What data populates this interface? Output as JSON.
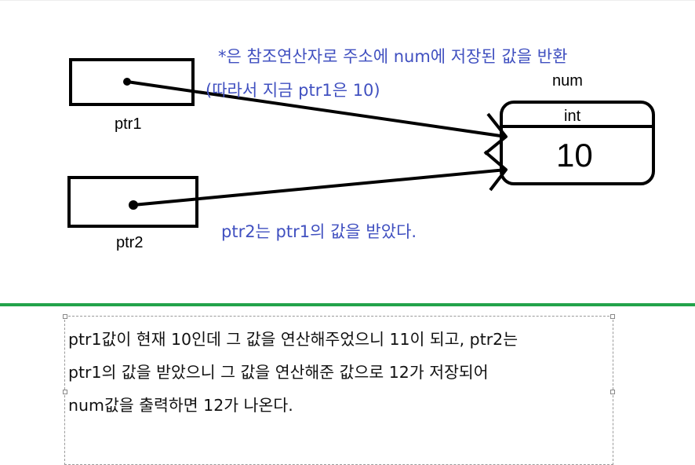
{
  "pointers": [
    {
      "name": "ptr1"
    },
    {
      "name": "ptr2"
    }
  ],
  "variable": {
    "name": "num",
    "type": "int",
    "value": "10"
  },
  "annotations": {
    "deref_line1": "*은 참조연산자로 주소에 num에 저장된 값을 반환",
    "deref_line2": "(따라서 지금 ptr1은 10)",
    "ptr2_note": "ptr2는 ptr1의 값을 받았다."
  },
  "explanation": {
    "lines": [
      "ptr1값이 현재 10인데 그 값을 연산해주었으니 11이 되고, ptr2는",
      "ptr1의 값을 받았으니 그 값을 연산해준 값으로 12가 저장되어",
      "num값을 출력하면 12가 나온다."
    ]
  },
  "colors": {
    "annotation": "#4050c0",
    "divider": "#22a34a",
    "stroke": "#000000"
  }
}
